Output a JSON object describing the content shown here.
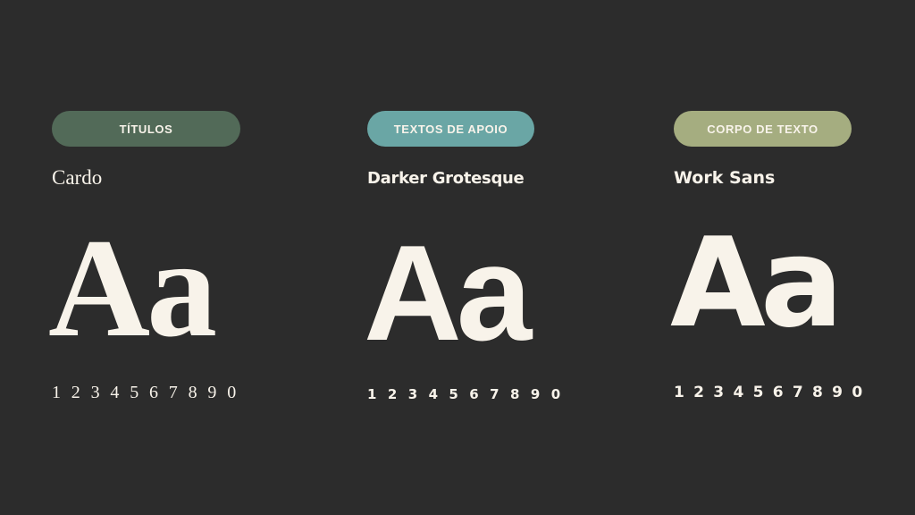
{
  "columns": [
    {
      "label": "TÍTULOS",
      "font_name": "Cardo",
      "sample": "Aa",
      "digits": "1 2 3 4 5 6 7 8 9 0",
      "pill_color": "#526a58"
    },
    {
      "label": "TEXTOS DE APOIO",
      "font_name": "Darker Grotesque",
      "sample": "Aa",
      "digits": "1 2 3 4 5 6 7 8 9 0",
      "pill_color": "#6aa6a5"
    },
    {
      "label": "CORPO DE TEXTO",
      "font_name": "Work Sans",
      "sample": "Aa",
      "digits": "1 2 3 4 5 6 7 8 9 0",
      "pill_color": "#a5ad80"
    }
  ],
  "colors": {
    "background": "#2c2c2c",
    "text": "#f8f3ea"
  }
}
